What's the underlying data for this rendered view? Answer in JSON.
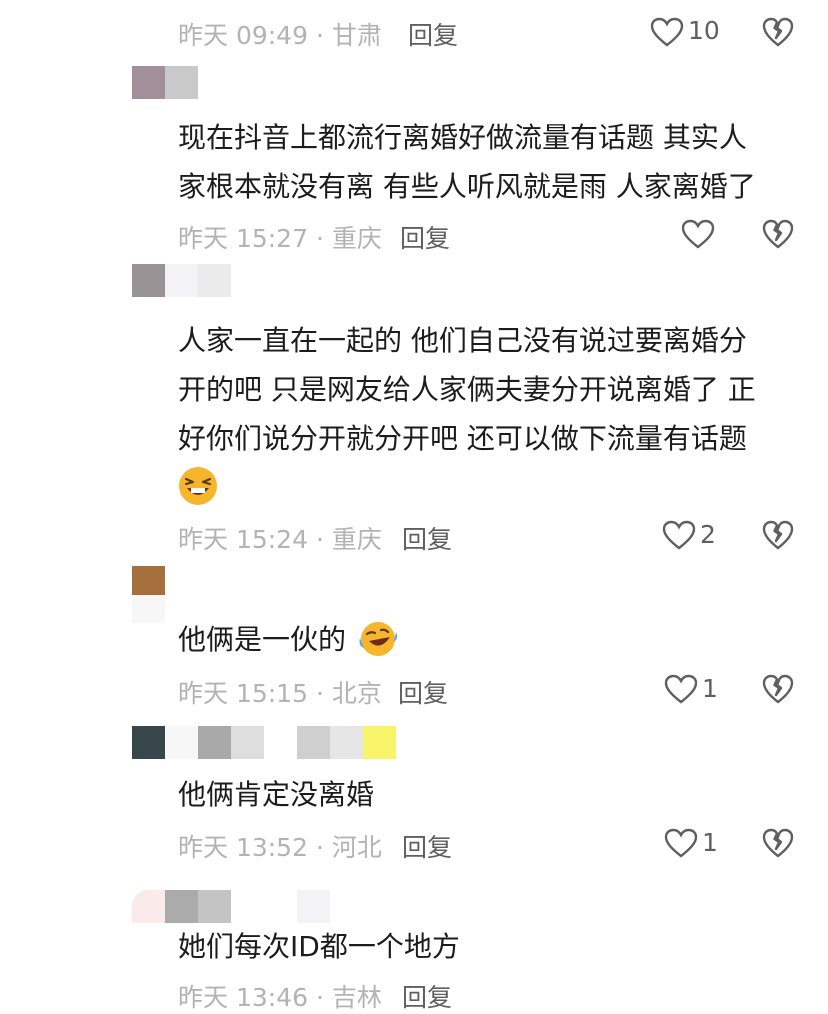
{
  "comments": [
    {
      "meta": "昨天 09:49 · 甘肃",
      "reply": "回复",
      "likes": "10",
      "lines": []
    },
    {
      "meta": "昨天 15:27 · 重庆",
      "reply": "回复",
      "likes": "",
      "lines": [
        "现在抖音上都流行离婚好做流量有话题 其实人",
        "家根本就没有离 有些人听风就是雨 人家离婚了"
      ]
    },
    {
      "meta": "昨天 15:24 · 重庆",
      "reply": "回复",
      "likes": "2",
      "lines": [
        "人家一直在一起的 他们自己没有说过要离婚分",
        "开的吧 只是网友给人家俩夫妻分开说离婚了 正",
        "好你们说分开就分开吧 还可以做下流量有话题"
      ],
      "emoji": "laughing-emoji"
    },
    {
      "meta": "昨天 15:15 · 北京",
      "reply": "回复",
      "likes": "1",
      "lines": [
        "他俩是一伙的"
      ],
      "emoji": "rolling-laughing-emoji"
    },
    {
      "meta": "昨天 13:52 · 河北",
      "reply": "回复",
      "likes": "1",
      "lines": [
        "他俩肯定没离婚"
      ]
    },
    {
      "meta": "昨天 13:46 · 吉林",
      "reply": "回复",
      "likes": "",
      "lines": [
        "她们每次ID都一个地方"
      ]
    }
  ],
  "colors": {
    "meta": "#b3b3b3",
    "reply": "#5f5f5f",
    "text": "#1c1c1c",
    "icon": "#5f5f5f"
  },
  "icons": [
    "heart-icon",
    "broken-heart-icon"
  ]
}
